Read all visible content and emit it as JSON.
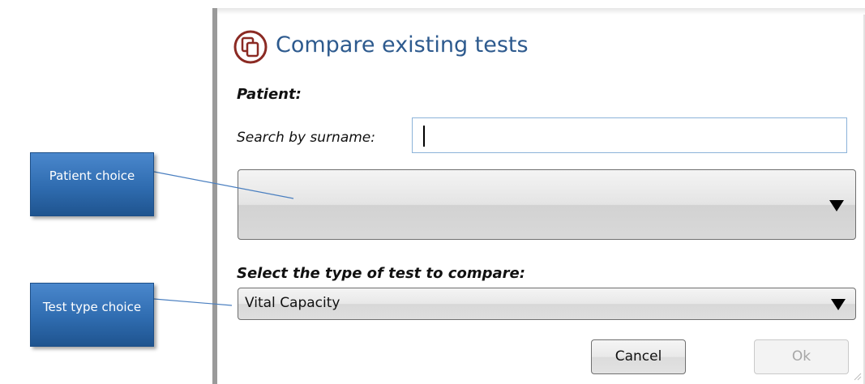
{
  "dialog": {
    "title": "Compare existing tests",
    "title_icon": "compare-pages-icon",
    "patient_label": "Patient:",
    "search_label": "Search by surname:",
    "search_value": "",
    "patient_selected": "",
    "test_type_label": "Select the type of test to compare:",
    "test_type_selected": "Vital Capacity",
    "cancel_label": "Cancel",
    "ok_label": "Ok",
    "ok_enabled": false
  },
  "callouts": {
    "patient_choice": "Patient choice",
    "test_type_choice": "Test type choice"
  },
  "colors": {
    "title": "#2d5a8e",
    "callout_fill": "#2f6cb0",
    "icon": "#8b2a23",
    "connector": "#4a7fc0"
  }
}
